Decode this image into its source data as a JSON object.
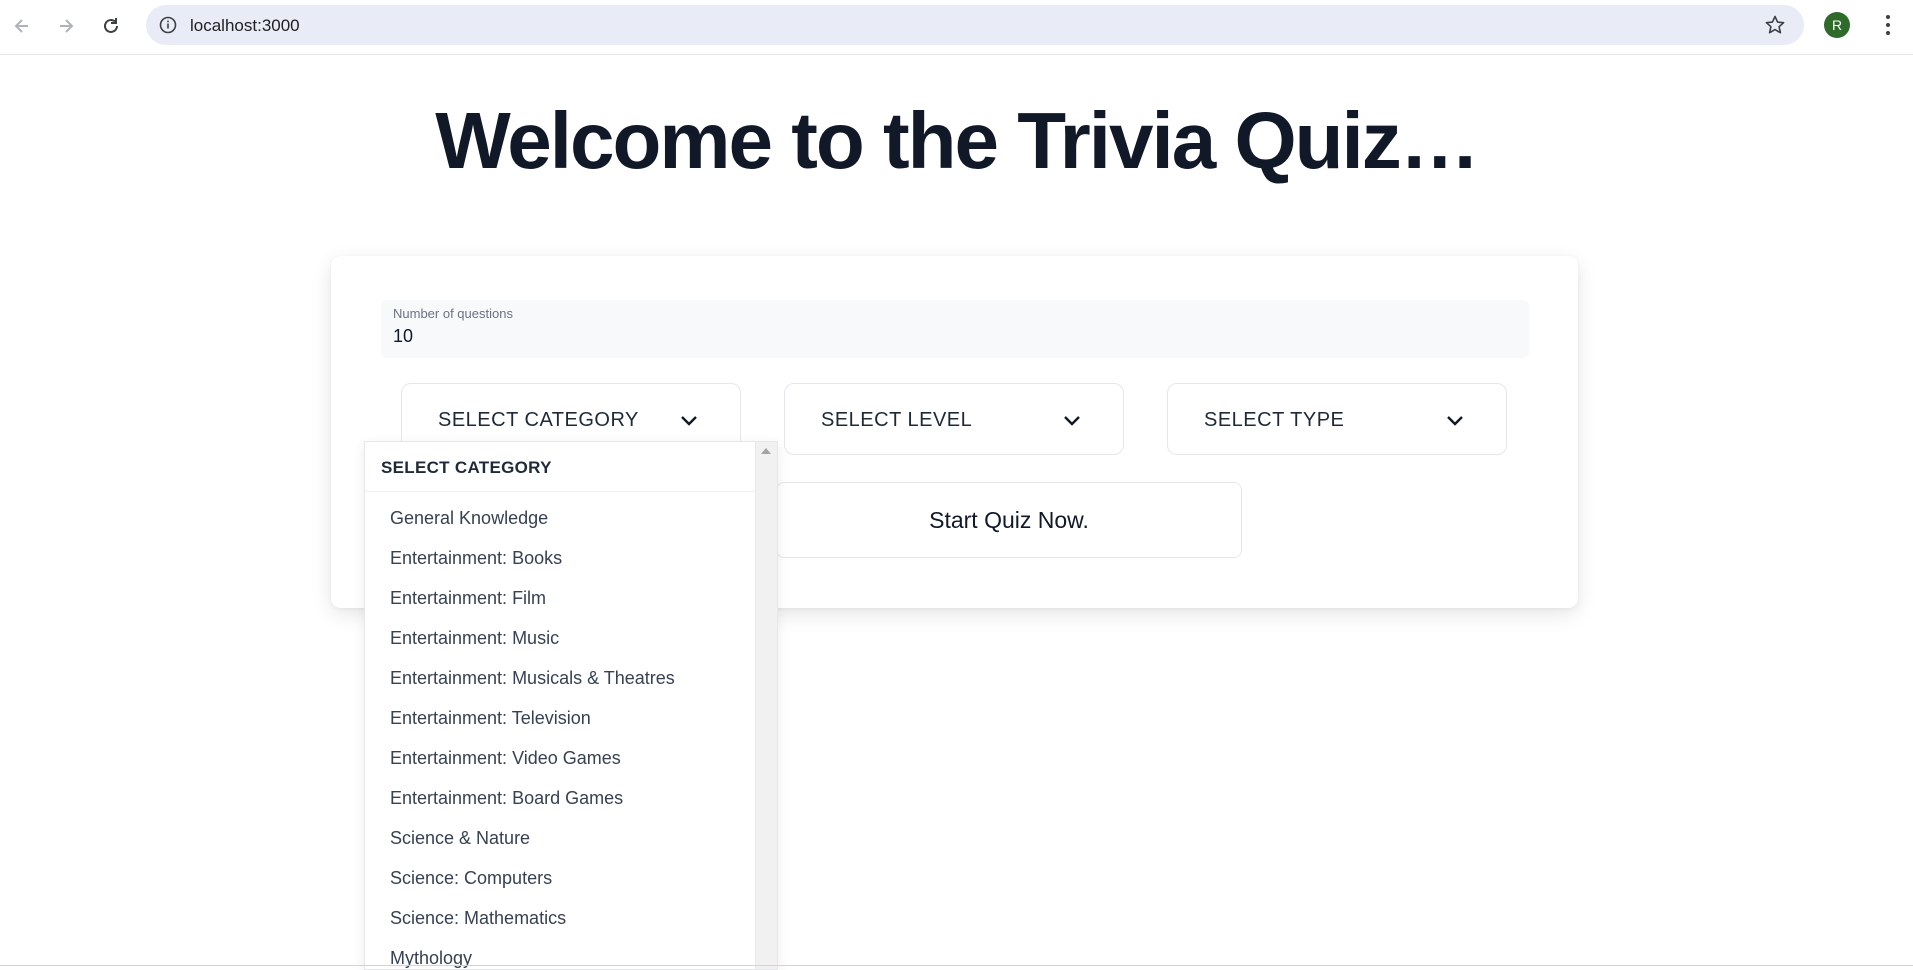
{
  "browser": {
    "url": "localhost:3000",
    "avatar_initial": "R"
  },
  "page": {
    "title": "Welcome to the Trivia Quiz…"
  },
  "form": {
    "questions_label": "Number of questions",
    "questions_value": "10",
    "category_label": "SELECT CATEGORY",
    "level_label": "SELECT LEVEL",
    "type_label": "SELECT TYPE",
    "start_button": "Start Quiz Now."
  },
  "dropdown": {
    "header": "SELECT CATEGORY",
    "options": [
      "General Knowledge",
      "Entertainment: Books",
      "Entertainment: Film",
      "Entertainment: Music",
      "Entertainment: Musicals & Theatres",
      "Entertainment: Television",
      "Entertainment: Video Games",
      "Entertainment: Board Games",
      "Science & Nature",
      "Science: Computers",
      "Science: Mathematics",
      "Mythology"
    ]
  },
  "colors": {
    "title": "#111827",
    "address_bar_bg": "#e9ebf6",
    "avatar_bg": "#2e6b2b"
  }
}
